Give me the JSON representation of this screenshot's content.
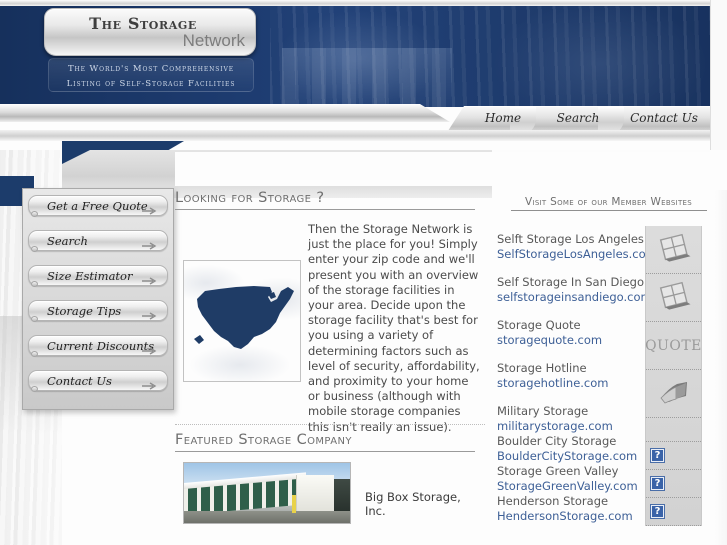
{
  "site": {
    "logo_line1": "The Storage",
    "logo_line2": "Network",
    "tagline_line1": "The World's Most Comprehensive",
    "tagline_line2": "Listing of Self-Storage Facilities"
  },
  "topnav": {
    "items": [
      {
        "label": "Home"
      },
      {
        "label": "Search"
      },
      {
        "label": "Contact Us"
      }
    ]
  },
  "sidebar": {
    "items": [
      {
        "label": "Get a Free Quote",
        "icon": "arrow-right-icon"
      },
      {
        "label": "Search",
        "icon": "arrow-right-icon"
      },
      {
        "label": "Size Estimator",
        "icon": "arrow-right-icon"
      },
      {
        "label": "Storage Tips",
        "icon": "arrow-right-icon"
      },
      {
        "label": "Current Discounts",
        "icon": "arrow-right-icon"
      },
      {
        "label": "Contact Us",
        "icon": "arrow-right-icon"
      }
    ]
  },
  "main": {
    "heading": "Looking for Storage ?",
    "map_alt": "united-states-map",
    "body": "Then the Storage Network is just the place for you! Simply enter your zip code and we'll present you with an overview of the storage facilities in your area. Decide upon the storage facility that's best for you using a variety of determining factors such as level of security, affordability, and proximity to your home or business (although with mobile storage companies this isn't really an issue)."
  },
  "featured": {
    "heading": "Featured Storage Company",
    "photo_alt": "storage-facility-photo",
    "company_name": "Big Box Storage, Inc."
  },
  "members": {
    "heading": "Visit Some of our Member Websites",
    "entries": [
      {
        "title": "Selft Storage Los Angeles",
        "link": "SelfStorageLosAngeles.com"
      },
      {
        "title": "Self Storage In San Diego",
        "link": "selfstorageinsandiego.com"
      },
      {
        "title": "Storage Quote",
        "link": "storagequote.com"
      },
      {
        "title": "Storage Hotline",
        "link": "storagehotline.com"
      },
      {
        "title": "Military Storage",
        "link": "militarystorage.com"
      },
      {
        "title": "Boulder City Storage",
        "link": "BoulderCityStorage.com"
      },
      {
        "title": "Storage Green Valley",
        "link": "StorageGreenValley.com"
      },
      {
        "title": "Henderson Storage",
        "link": "HendersonStorage.com"
      }
    ],
    "icons": [
      {
        "name": "window-grid-icon",
        "type": "image",
        "label": ""
      },
      {
        "name": "window-grid-icon",
        "type": "image",
        "label": ""
      },
      {
        "name": "quote-text-icon",
        "type": "text",
        "label": "QUOTE"
      },
      {
        "name": "book-pages-icon",
        "type": "image",
        "label": ""
      },
      {
        "name": "spacer-icon",
        "type": "spacer",
        "label": ""
      },
      {
        "name": "broken-image-icon",
        "type": "broken",
        "label": ""
      },
      {
        "name": "broken-image-icon",
        "type": "broken",
        "label": ""
      },
      {
        "name": "broken-image-icon",
        "type": "broken",
        "label": ""
      }
    ]
  },
  "colors": {
    "banner_navy": "#1c3c6b",
    "link_blue": "#3d5f96",
    "text_gray": "#585858",
    "heading_gray": "#6f6f6f",
    "silver": "#d2d2d2"
  }
}
